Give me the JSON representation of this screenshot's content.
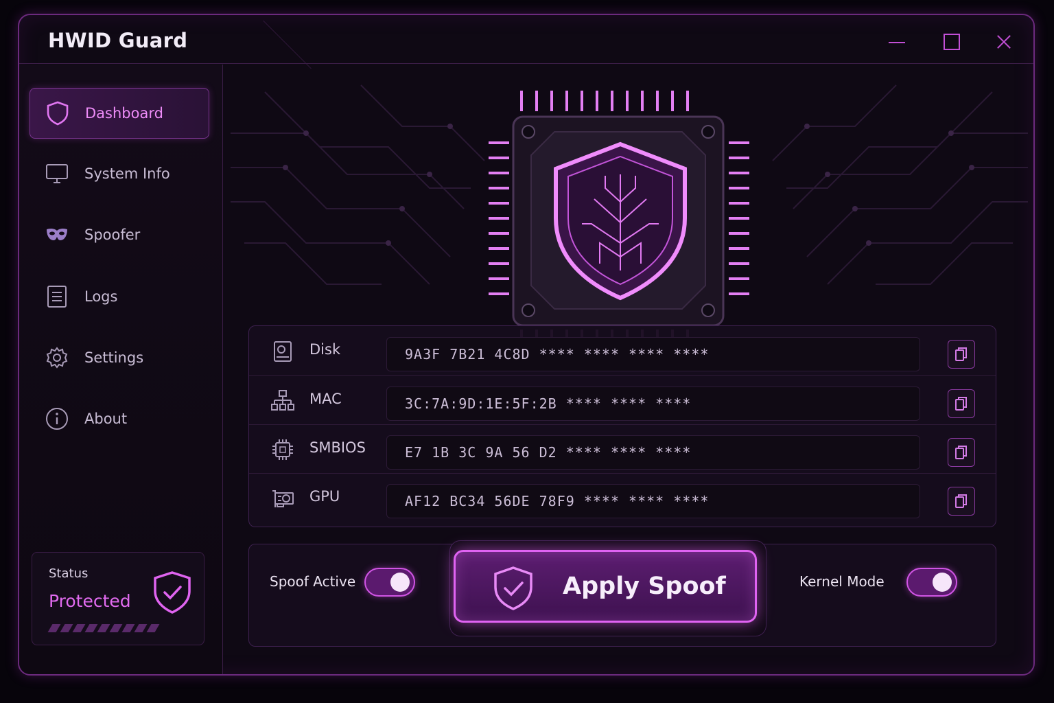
{
  "app": {
    "title": "HWID Guard"
  },
  "window_controls": {
    "minimize": "minimize-icon",
    "maximize": "maximize-icon",
    "close": "close-icon"
  },
  "sidebar": {
    "items": [
      {
        "label": "Dashboard",
        "icon": "shield-icon",
        "active": true
      },
      {
        "label": "System Info",
        "icon": "monitor-icon",
        "active": false
      },
      {
        "label": "Spoofer",
        "icon": "mask-icon",
        "active": false
      },
      {
        "label": "Logs",
        "icon": "document-icon",
        "active": false
      },
      {
        "label": "Settings",
        "icon": "gear-icon",
        "active": false
      },
      {
        "label": "About",
        "icon": "info-icon",
        "active": false
      }
    ],
    "status": {
      "label": "Status",
      "value": "Protected"
    }
  },
  "hwid": {
    "rows": [
      {
        "label": "Disk",
        "value": "9A3F 7B21 4C8D **** **** **** ****",
        "icon": "disk-icon"
      },
      {
        "label": "MAC",
        "value": "3C:7A:9D:1E:5F:2B **** **** ****",
        "icon": "network-icon"
      },
      {
        "label": "SMBIOS",
        "value": "E7 1B 3C 9A 56 D2 **** **** ****",
        "icon": "chip-icon"
      },
      {
        "label": "GPU",
        "value": "AF12 BC34 56DE 78F9 **** **** ****",
        "icon": "gpu-icon"
      }
    ]
  },
  "actions": {
    "spoof_active_label": "Spoof Active",
    "spoof_active_on": true,
    "apply_label": "Apply Spoof",
    "kernel_mode_label": "Kernel Mode",
    "kernel_mode_on": true
  },
  "colors": {
    "accent": "#d95ae8",
    "background": "#0f0914",
    "border": "#6c2a7e"
  }
}
